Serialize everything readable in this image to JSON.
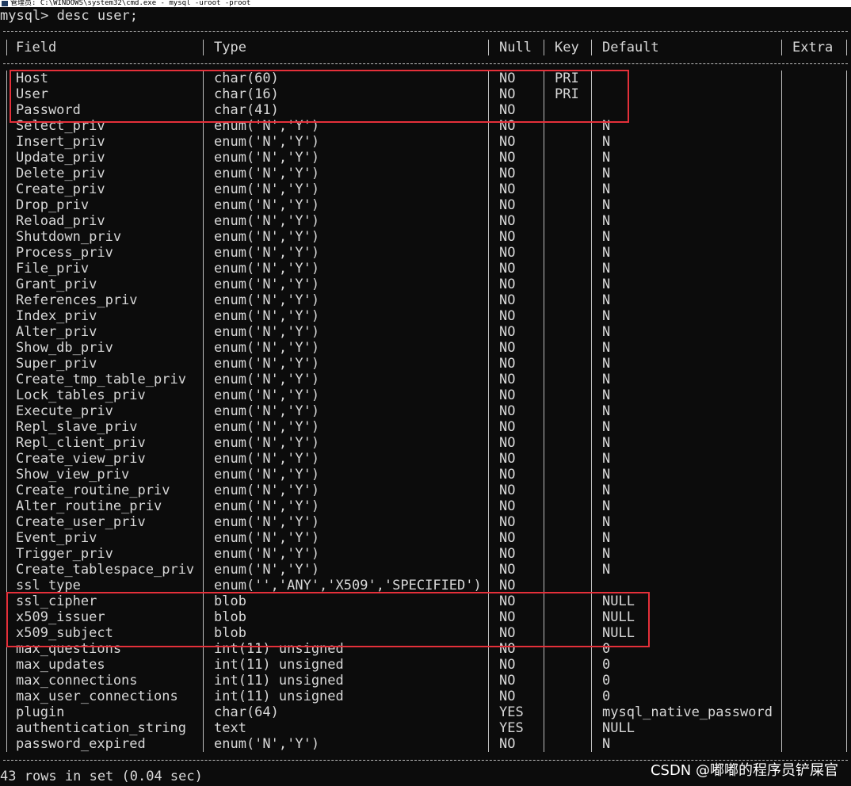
{
  "window": {
    "title": "管理员: C:\\WINDOWS\\system32\\cmd.exe - mysql -uroot -proot"
  },
  "prompt": "mysql> desc user;",
  "headers": {
    "field": "Field",
    "type": "Type",
    "null": "Null",
    "key": "Key",
    "default": "Default",
    "extra": "Extra"
  },
  "rows": [
    {
      "field": "Host",
      "type": "char(60)",
      "null": "NO",
      "key": "PRI",
      "default": "",
      "extra": ""
    },
    {
      "field": "User",
      "type": "char(16)",
      "null": "NO",
      "key": "PRI",
      "default": "",
      "extra": ""
    },
    {
      "field": "Password",
      "type": "char(41)",
      "null": "NO",
      "key": "",
      "default": "",
      "extra": ""
    },
    {
      "field": "Select_priv",
      "type": "enum('N','Y')",
      "null": "NO",
      "key": "",
      "default": "N",
      "extra": ""
    },
    {
      "field": "Insert_priv",
      "type": "enum('N','Y')",
      "null": "NO",
      "key": "",
      "default": "N",
      "extra": ""
    },
    {
      "field": "Update_priv",
      "type": "enum('N','Y')",
      "null": "NO",
      "key": "",
      "default": "N",
      "extra": ""
    },
    {
      "field": "Delete_priv",
      "type": "enum('N','Y')",
      "null": "NO",
      "key": "",
      "default": "N",
      "extra": ""
    },
    {
      "field": "Create_priv",
      "type": "enum('N','Y')",
      "null": "NO",
      "key": "",
      "default": "N",
      "extra": ""
    },
    {
      "field": "Drop_priv",
      "type": "enum('N','Y')",
      "null": "NO",
      "key": "",
      "default": "N",
      "extra": ""
    },
    {
      "field": "Reload_priv",
      "type": "enum('N','Y')",
      "null": "NO",
      "key": "",
      "default": "N",
      "extra": ""
    },
    {
      "field": "Shutdown_priv",
      "type": "enum('N','Y')",
      "null": "NO",
      "key": "",
      "default": "N",
      "extra": ""
    },
    {
      "field": "Process_priv",
      "type": "enum('N','Y')",
      "null": "NO",
      "key": "",
      "default": "N",
      "extra": ""
    },
    {
      "field": "File_priv",
      "type": "enum('N','Y')",
      "null": "NO",
      "key": "",
      "default": "N",
      "extra": ""
    },
    {
      "field": "Grant_priv",
      "type": "enum('N','Y')",
      "null": "NO",
      "key": "",
      "default": "N",
      "extra": ""
    },
    {
      "field": "References_priv",
      "type": "enum('N','Y')",
      "null": "NO",
      "key": "",
      "default": "N",
      "extra": ""
    },
    {
      "field": "Index_priv",
      "type": "enum('N','Y')",
      "null": "NO",
      "key": "",
      "default": "N",
      "extra": ""
    },
    {
      "field": "Alter_priv",
      "type": "enum('N','Y')",
      "null": "NO",
      "key": "",
      "default": "N",
      "extra": ""
    },
    {
      "field": "Show_db_priv",
      "type": "enum('N','Y')",
      "null": "NO",
      "key": "",
      "default": "N",
      "extra": ""
    },
    {
      "field": "Super_priv",
      "type": "enum('N','Y')",
      "null": "NO",
      "key": "",
      "default": "N",
      "extra": ""
    },
    {
      "field": "Create_tmp_table_priv",
      "type": "enum('N','Y')",
      "null": "NO",
      "key": "",
      "default": "N",
      "extra": ""
    },
    {
      "field": "Lock_tables_priv",
      "type": "enum('N','Y')",
      "null": "NO",
      "key": "",
      "default": "N",
      "extra": ""
    },
    {
      "field": "Execute_priv",
      "type": "enum('N','Y')",
      "null": "NO",
      "key": "",
      "default": "N",
      "extra": ""
    },
    {
      "field": "Repl_slave_priv",
      "type": "enum('N','Y')",
      "null": "NO",
      "key": "",
      "default": "N",
      "extra": ""
    },
    {
      "field": "Repl_client_priv",
      "type": "enum('N','Y')",
      "null": "NO",
      "key": "",
      "default": "N",
      "extra": ""
    },
    {
      "field": "Create_view_priv",
      "type": "enum('N','Y')",
      "null": "NO",
      "key": "",
      "default": "N",
      "extra": ""
    },
    {
      "field": "Show_view_priv",
      "type": "enum('N','Y')",
      "null": "NO",
      "key": "",
      "default": "N",
      "extra": ""
    },
    {
      "field": "Create_routine_priv",
      "type": "enum('N','Y')",
      "null": "NO",
      "key": "",
      "default": "N",
      "extra": ""
    },
    {
      "field": "Alter_routine_priv",
      "type": "enum('N','Y')",
      "null": "NO",
      "key": "",
      "default": "N",
      "extra": ""
    },
    {
      "field": "Create_user_priv",
      "type": "enum('N','Y')",
      "null": "NO",
      "key": "",
      "default": "N",
      "extra": ""
    },
    {
      "field": "Event_priv",
      "type": "enum('N','Y')",
      "null": "NO",
      "key": "",
      "default": "N",
      "extra": ""
    },
    {
      "field": "Trigger_priv",
      "type": "enum('N','Y')",
      "null": "NO",
      "key": "",
      "default": "N",
      "extra": ""
    },
    {
      "field": "Create_tablespace_priv",
      "type": "enum('N','Y')",
      "null": "NO",
      "key": "",
      "default": "N",
      "extra": ""
    },
    {
      "field": "ssl_type",
      "type": "enum('','ANY','X509','SPECIFIED')",
      "null": "NO",
      "key": "",
      "default": "",
      "extra": ""
    },
    {
      "field": "ssl_cipher",
      "type": "blob",
      "null": "NO",
      "key": "",
      "default": "NULL",
      "extra": ""
    },
    {
      "field": "x509_issuer",
      "type": "blob",
      "null": "NO",
      "key": "",
      "default": "NULL",
      "extra": ""
    },
    {
      "field": "x509_subject",
      "type": "blob",
      "null": "NO",
      "key": "",
      "default": "NULL",
      "extra": ""
    },
    {
      "field": "max_questions",
      "type": "int(11) unsigned",
      "null": "NO",
      "key": "",
      "default": "0",
      "extra": ""
    },
    {
      "field": "max_updates",
      "type": "int(11) unsigned",
      "null": "NO",
      "key": "",
      "default": "0",
      "extra": ""
    },
    {
      "field": "max_connections",
      "type": "int(11) unsigned",
      "null": "NO",
      "key": "",
      "default": "0",
      "extra": ""
    },
    {
      "field": "max_user_connections",
      "type": "int(11) unsigned",
      "null": "NO",
      "key": "",
      "default": "0",
      "extra": ""
    },
    {
      "field": "plugin",
      "type": "char(64)",
      "null": "YES",
      "key": "",
      "default": "mysql_native_password",
      "extra": ""
    },
    {
      "field": "authentication_string",
      "type": "text",
      "null": "YES",
      "key": "",
      "default": "NULL",
      "extra": ""
    },
    {
      "field": "password_expired",
      "type": "enum('N','Y')",
      "null": "NO",
      "key": "",
      "default": "N",
      "extra": ""
    }
  ],
  "footer": "43 rows in set (0.04 sec)",
  "watermark": "CSDN @嘟嘟的程序员铲屎官",
  "colors": {
    "background": "#0c0c0c",
    "text": "#d8d8d8",
    "highlight": "#e5303a"
  }
}
